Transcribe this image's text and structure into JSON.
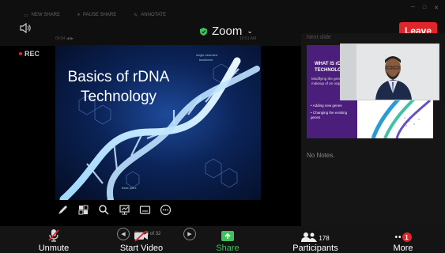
{
  "window": {
    "menu_items": [
      "NEW SHARE",
      "PAUSE SHARE",
      "ANNOTATE"
    ],
    "title": "Zoom",
    "leave_label": "Leave",
    "slide_counter": "00:54 ◀ ▶",
    "clock": "10:51 AM"
  },
  "recording": {
    "label": "REC",
    "color": "#e0262a"
  },
  "current_slide": {
    "title_line1": "Basics of rDNA",
    "title_line2": "Technology",
    "small_text_1": "single stranded",
    "small_text_2": "backbone",
    "small_text_3": "base pairs"
  },
  "annotation_tools": [
    "pen-icon",
    "select-icon",
    "zoom-icon",
    "board-icon",
    "subtitle-icon",
    "more-icon"
  ],
  "right_panel": {
    "next_slide_label": "Next slide",
    "next_slide": {
      "title": "WHAT IS rDNA TECHNOLOGY?",
      "subtitle": "Modifying the genetic makeup of an organism",
      "bullets": [
        "Adding new genes",
        "Changing the existing genes"
      ]
    },
    "notes": "No Notes."
  },
  "bottom_bar": {
    "unmute": "Unmute",
    "start_video": "Start Video",
    "share": "Share",
    "participants": "Participants",
    "participants_count": "178",
    "more": "More",
    "more_badge": "1",
    "page_indicator": "Slide 5 of 32"
  },
  "colors": {
    "leave": "#e0262a",
    "share_green": "#3ec35b",
    "slide_blue": "#0b2357",
    "next_slide_purple": "#4a1e7a"
  }
}
